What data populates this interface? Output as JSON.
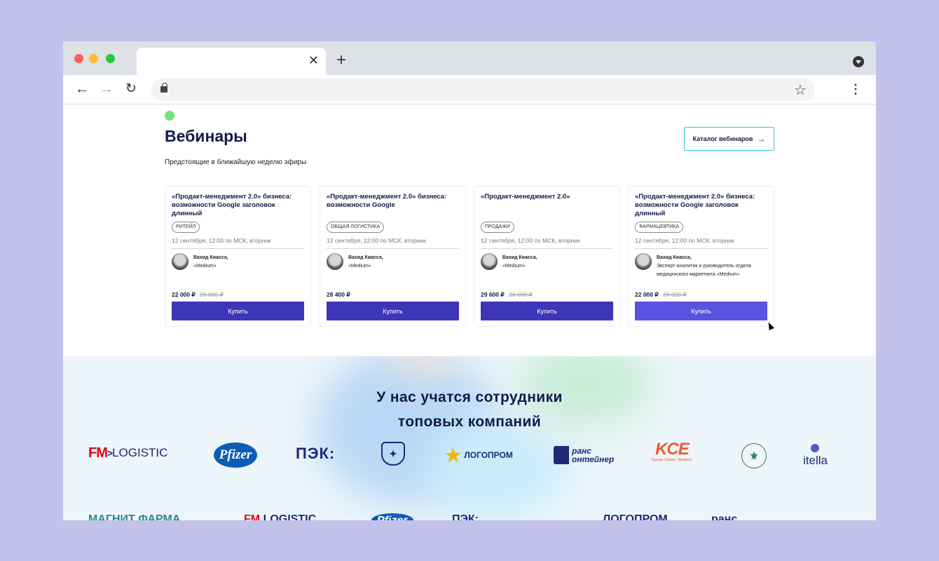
{
  "browser": {
    "tab_close": "✕",
    "new_tab": "+",
    "back": "←",
    "forward": "→",
    "reload": "↻",
    "star": "☆",
    "menu": "⋮"
  },
  "webinars": {
    "title": "Вебинары",
    "subtitle": "Предстоящие  в ближайшую неделю эфиры",
    "catalog_button": "Каталог вебинаров",
    "catalog_arrow": "→",
    "cards": [
      {
        "title": "«Продакт-менеджмент 2.0» бизнеса: возможности Google заголовок длинный",
        "tag": "РИТЕЙЛ",
        "date": "12 сентября, 12:00 по МСК, вторник",
        "speaker_name": "Вахид Киасса,",
        "speaker_info": "«Medium»",
        "price": "22 000 ₽",
        "old_price": "26 000 ₽",
        "buy": "Купить"
      },
      {
        "title": "«Продакт-менеджмент 2.0» бизнеса: возможности Google",
        "tag": "ОБЩАЯ ЛОГИСТИКА",
        "date": "12 сентября, 12:00 по МСК, вторник",
        "speaker_name": "Вахид Киасса,",
        "speaker_info": "«Medium»",
        "price": "28 400 ₽",
        "old_price": "",
        "buy": "Купить"
      },
      {
        "title": "«Продакт-менеджмент 2.0»",
        "tag": "ПРОДАЖИ",
        "date": "12 сентября, 12:00 по МСК, вторник",
        "speaker_name": "Вахид Киасса,",
        "speaker_info": "«Medium»",
        "price": "29 600 ₽",
        "old_price": "26 000 ₽",
        "buy": "Купить"
      },
      {
        "title": "«Продакт-менеджмент 2.0» бизнеса: возможности Google заголовок длинный",
        "tag": "ФАРМАЦЕВТИКА",
        "date": "12 сентября, 12:00 по МСК, вторник",
        "speaker_name": "Вахид Киасса,",
        "speaker_info": "Эксперт-аналитик и руководитель отдела медицинского маркетинга «Medium»",
        "price": "22 000 ₽",
        "old_price": "26 000 ₽",
        "buy": "Купить"
      }
    ]
  },
  "clients": {
    "title_line1": "У нас учатся сотрудники",
    "title_line2": "топовых компаний",
    "logos": {
      "fm_brand": "FM",
      "fm_rest": "LOGISTIC",
      "pfizer": "Pfizer",
      "pek": "ПЭК:",
      "logoprom_star": "★",
      "logoprom": "ЛОГОПРОМ",
      "trans_line1": "ранс",
      "trans_line2": "онтейнер",
      "kce": "KCE",
      "kce_sub": "Курьер Сервис Экспресс",
      "itella": "itella"
    },
    "row2": {
      "magnit": "МАГНИТ",
      "magnit_sub": "ФАРМА",
      "fm_brand": "FM",
      "fm_rest": "LOGISTIC",
      "pfizer": "Pfizer",
      "pek": "ПЭК:",
      "logoprom": "ЛОГОПРОМ",
      "trans": "ранс"
    }
  },
  "colors": {
    "brand_dark": "#121a4b",
    "button": "#3d36b8",
    "accent_teal": "#32c9d3",
    "page_bg": "#c3c2ea"
  }
}
